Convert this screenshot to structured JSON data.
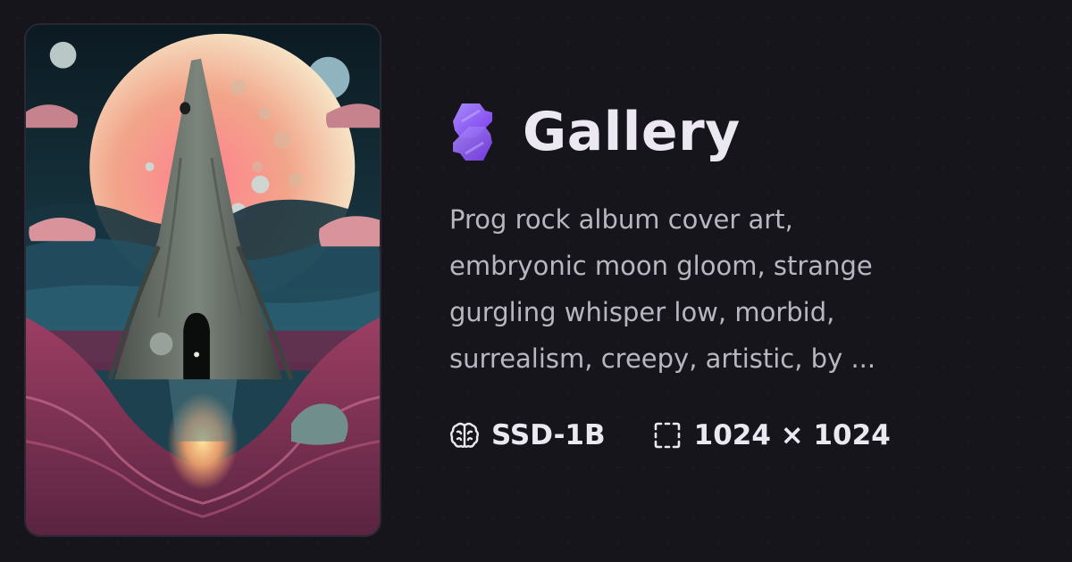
{
  "brand": {
    "title": "Gallery",
    "logo_icon": "gallery-logo-icon",
    "logo_color": "#8b5cf6"
  },
  "image": {
    "prompt_lines": [
      "Prog rock album cover art,",
      "embryonic moon gloom, strange",
      "gurgling whisper low, morbid,",
      "surrealism, creepy, artistic, by ..."
    ]
  },
  "meta": {
    "model": {
      "icon": "brain-icon",
      "label": "SSD-1B"
    },
    "size": {
      "icon": "dashed-frame-icon",
      "width": "1024",
      "separator": "×",
      "height": "1024",
      "label": "1024 × 1024"
    }
  },
  "colors": {
    "background": "#16151c",
    "title_text": "#ebe8f2",
    "body_text": "#b9b6c2"
  }
}
